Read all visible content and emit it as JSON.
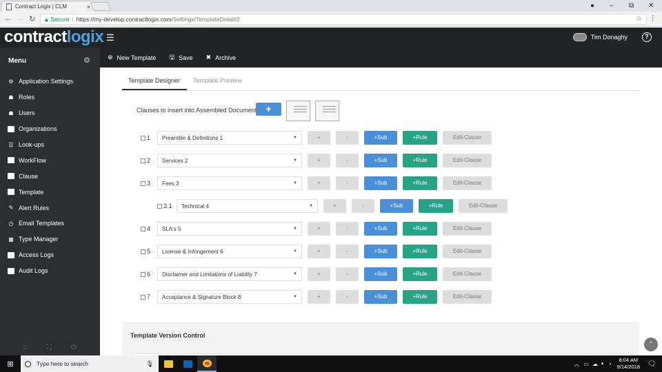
{
  "browser": {
    "tab_title": "Contract Logix | CLM",
    "tab_close": "×",
    "security_label": "Secure",
    "url_host": "https://my-develop.contractlogix.com",
    "url_path": "/Settings/TemplateDetail/2",
    "minimize": "–",
    "restore": "⧉",
    "close": "✕",
    "star": "☆",
    "menu": "⋮"
  },
  "header": {
    "logo_part1": "contract",
    "logo_part2": "logix",
    "user_name": "Tim Donaghy",
    "help": "?"
  },
  "sidebar": {
    "title": "Menu",
    "items": [
      {
        "label": "Application Settings",
        "icon": "cogs-icon"
      },
      {
        "label": "Roles",
        "icon": "users-icon"
      },
      {
        "label": "Users",
        "icon": "user-icon"
      },
      {
        "label": "Organizations",
        "icon": "building-icon"
      },
      {
        "label": "Look-ups",
        "icon": "list-icon"
      },
      {
        "label": "WorkFlow",
        "icon": "window-icon"
      },
      {
        "label": "Clause",
        "icon": "window-icon"
      },
      {
        "label": "Template",
        "icon": "window-icon"
      },
      {
        "label": "Alert Rules",
        "icon": "edit-icon"
      },
      {
        "label": "Email Templates",
        "icon": "clock-icon"
      },
      {
        "label": "Type Manager",
        "icon": "grid-icon"
      },
      {
        "label": "Access Logs",
        "icon": "window-icon"
      },
      {
        "label": "Audit Logs",
        "icon": "window-icon"
      }
    ]
  },
  "toolbar": {
    "new_template": "New Template",
    "save": "Save",
    "archive": "Archive"
  },
  "main": {
    "tabs": [
      "Template Designer",
      "Template Preview"
    ],
    "clauses_label": "Clauses to insert into Assembled Document",
    "add_label": "+",
    "buttons": {
      "plus": "+",
      "minus": "-",
      "sub": "+Sub",
      "rule": "+Rule",
      "edit": "Edit-Clause"
    },
    "clauses": [
      {
        "num": "1",
        "name": "Preamble & Definitions 1"
      },
      {
        "num": "2",
        "name": "Services 2"
      },
      {
        "num": "3",
        "name": "Fees 3"
      },
      {
        "num": "3.1",
        "name": "Technical 4"
      },
      {
        "num": "4",
        "name": "SLA's 5"
      },
      {
        "num": "5",
        "name": "License & Infringement 6"
      },
      {
        "num": "6",
        "name": "Disclaimer and Limitations of Liability 7"
      },
      {
        "num": "7",
        "name": "Acceptance & Signature Block 8"
      }
    ],
    "version_title": "Template Version Control"
  },
  "taskbar": {
    "search_placeholder": "Type here to search",
    "time": "8:04 AM",
    "date": "9/14/2018"
  }
}
